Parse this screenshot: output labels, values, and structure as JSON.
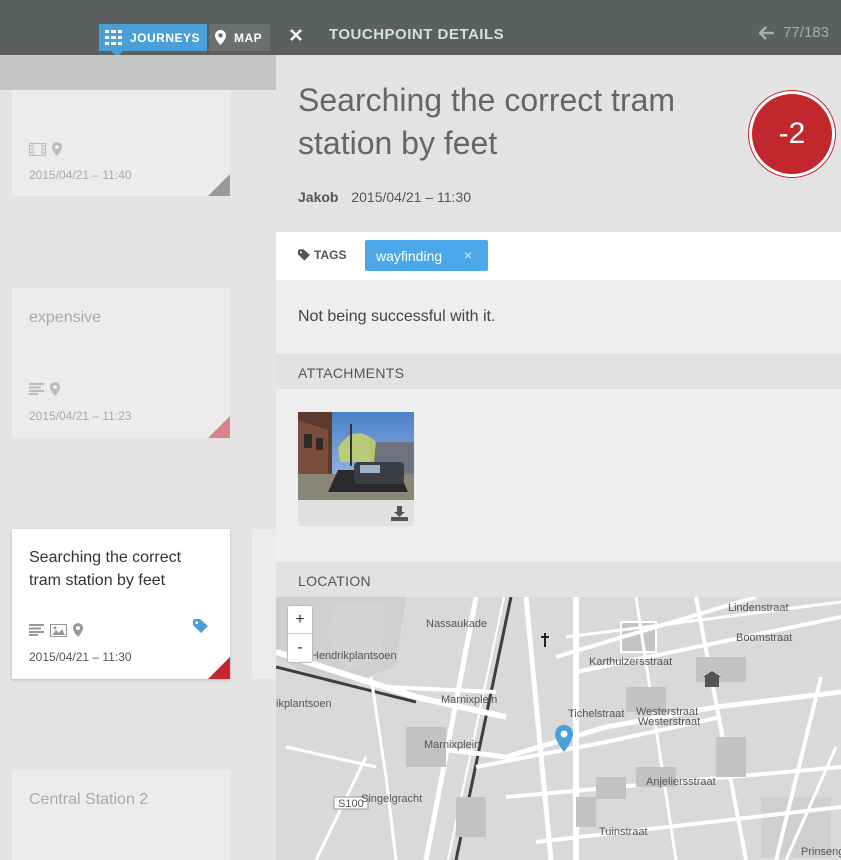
{
  "nav": {
    "journeys_label": "JOURNEYS",
    "map_label": "MAP"
  },
  "cards": [
    {
      "title": "",
      "date": "2015/04/21 – 11:40",
      "icons": [
        "film-icon",
        "location-pin-icon"
      ],
      "corner_color": "#9a9a9a"
    },
    {
      "title": "expensive",
      "date": "2015/04/21 – 11:23",
      "icons": [
        "text-lines-icon",
        "location-pin-icon"
      ],
      "corner_color": "#d9848a"
    },
    {
      "title": "Searching the correct tram station by feet",
      "date": "2015/04/21 – 11:30",
      "icons": [
        "text-lines-icon",
        "image-icon",
        "location-pin-icon",
        "tag-icon"
      ],
      "corner_color": "#c1272d",
      "active": true
    },
    {
      "title": "Central Station 2",
      "date": "",
      "icons": []
    }
  ],
  "panel": {
    "header_title": "TOUCHPOINT DETAILS",
    "pager": "77/183",
    "title": "Searching the correct tram station by feet",
    "score": "-2",
    "score_color": "#c1272d",
    "author": "Jakob",
    "timestamp": "2015/04/21 – 11:30",
    "tags_label": "TAGS",
    "tags": [
      {
        "label": "wayfinding",
        "remove": "×"
      }
    ],
    "description": "Not being successful with it.",
    "attachments_label": "ATTACHMENTS",
    "location_label": "LOCATION"
  },
  "map": {
    "zoom_in": "+",
    "zoom_out": "-",
    "streets": [
      "Lindenstraat",
      "Boomstraat",
      "Karthuizersstraat",
      "Tichelstraat",
      "Westerstraat",
      "Westerstraat",
      "Marnixplein",
      "Marnixplein",
      "Hendrikplantsoen",
      "ikplantsoen",
      "Nassaukade",
      "Anjeliersstraat",
      "Tuinstraat",
      "Prinsengracht",
      "S100",
      "Singelgracht"
    ],
    "accent": "#4a9fd8"
  }
}
